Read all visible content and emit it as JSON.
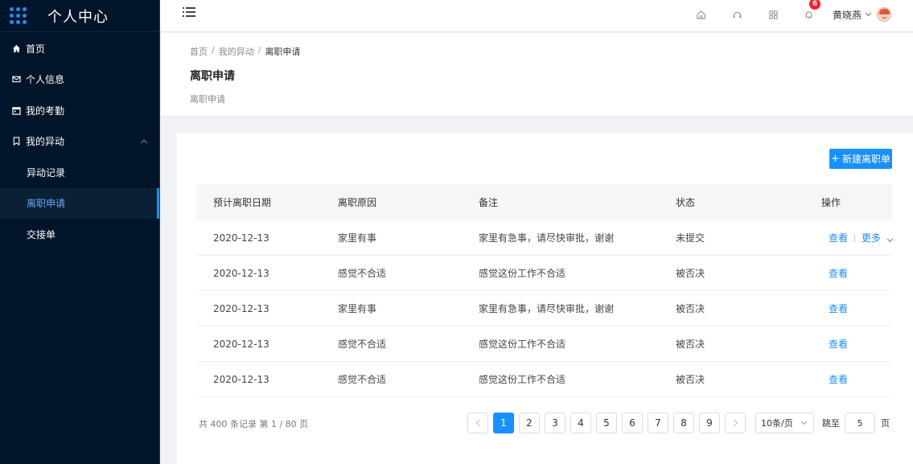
{
  "app": {
    "title": "个人中心"
  },
  "sidebar": {
    "items": [
      {
        "label": "首页",
        "icon": "home-icon"
      },
      {
        "label": "个人信息",
        "icon": "mail-icon"
      },
      {
        "label": "我的考勤",
        "icon": "calendar-icon"
      },
      {
        "label": "我的异动",
        "icon": "bookmark-icon",
        "expanded": true
      }
    ],
    "sub_items": [
      {
        "label": "异动记录",
        "active": false
      },
      {
        "label": "离职申请",
        "active": true
      },
      {
        "label": "交接单",
        "active": false
      }
    ]
  },
  "header": {
    "notification_count": "6",
    "user_name": "黄晓燕",
    "icons": [
      "menu-icon",
      "home-icon",
      "headset-icon",
      "apps-icon",
      "bell-icon"
    ]
  },
  "page": {
    "breadcrumb": [
      "首页",
      "我的异动",
      "离职申请"
    ],
    "breadcrumb_sep": "/",
    "title": "离职申请",
    "description": "离职申请"
  },
  "toolbar": {
    "new_button_label": "新建离职单",
    "new_button_icon": "+"
  },
  "table": {
    "columns": [
      "预计离职日期",
      "离职原因",
      "备注",
      "状态",
      "操作"
    ],
    "rows": [
      {
        "date": "2020-12-13",
        "reason": "家里有事",
        "note": "家里有急事，请尽快审批，谢谢",
        "status": "未提交",
        "view": "查看",
        "more": "更多"
      },
      {
        "date": "2020-12-13",
        "reason": "感觉不合适",
        "note": "感觉这份工作不合适",
        "status": "被否决",
        "view": "查看"
      },
      {
        "date": "2020-12-13",
        "reason": "家里有事",
        "note": "家里有急事，请尽快审批，谢谢",
        "status": "被否决",
        "view": "查看"
      },
      {
        "date": "2020-12-13",
        "reason": "感觉不合适",
        "note": "感觉这份工作不合适",
        "status": "被否决",
        "view": "查看"
      },
      {
        "date": "2020-12-13",
        "reason": "感觉不合适",
        "note": "感觉这份工作不合适",
        "status": "被否决",
        "view": "查看"
      }
    ]
  },
  "pagination": {
    "summary": "共 400 条记录 第 1 / 80 页",
    "pages": [
      "1",
      "2",
      "3",
      "4",
      "5",
      "6",
      "7",
      "8",
      "9"
    ],
    "current": "1",
    "page_size": "10条/页",
    "jump_label": "跳至",
    "jump_value": "5",
    "jump_unit": "页"
  },
  "colors": {
    "primary": "#1890ff",
    "sidebar_bg": "#001529",
    "badge": "#f5222d"
  }
}
